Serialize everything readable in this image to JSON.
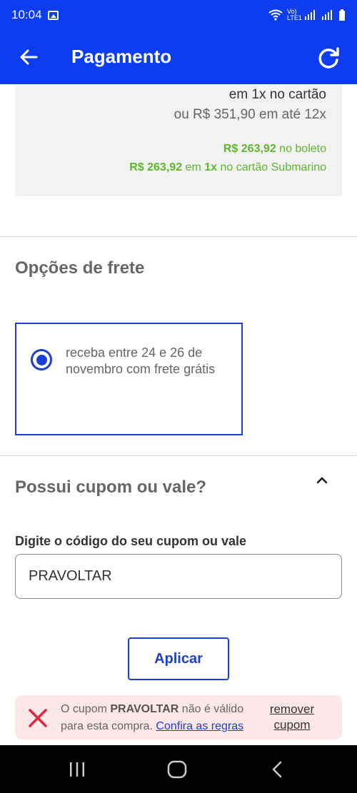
{
  "status_bar": {
    "time": "10:04",
    "network": "Vo) LTE1"
  },
  "app_bar": {
    "title": "Pagamento"
  },
  "price_card": {
    "line1": "em 1x no cartão",
    "line2": "ou R$ 351,90 em até 12x",
    "boleto_price": "R$ 263,92",
    "boleto_suffix": " no boleto",
    "card_price": "R$ 263,92",
    "card_em": " em ",
    "card_installments": "1x",
    "card_suffix": " no cartão Submarino"
  },
  "shipping": {
    "title": "Opções de frete",
    "option_text": "receba entre 24 e 26 de novembro com frete grátis",
    "option_selected": true
  },
  "coupon": {
    "title": "Possui cupom ou vale?",
    "field_label": "Digite o código do seu cupom ou vale",
    "field_value": "PRAVOLTAR",
    "apply_label": "Aplicar",
    "error_prefix": "O cupom ",
    "error_code": "PRAVOLTAR",
    "error_suffix": " não é válido para esta compra. ",
    "rules_link": "Confira as regras",
    "remove_label": "remover cupom"
  },
  "colors": {
    "brand_blue": "#0d3df0",
    "accent_blue": "#1a3fd6",
    "price_green": "#5cb82a",
    "error_red": "#e0263c",
    "error_bg": "#fde7e8"
  }
}
